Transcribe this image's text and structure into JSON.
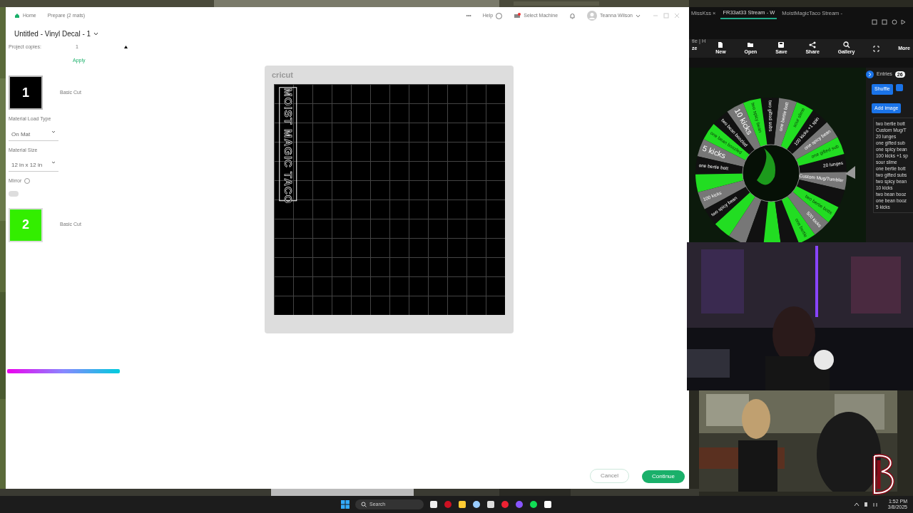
{
  "cricut": {
    "breadcrumbs": [
      {
        "label": "Home",
        "kind": "home"
      },
      {
        "label": "Prepare (2 mats)",
        "kind": "plain"
      }
    ],
    "header": {
      "more": "•••",
      "help": "Help",
      "machine": "Select Machine",
      "user": "Teanna Wilson"
    },
    "project_title": "Untitled - Vinyl Decal - 1",
    "copies": {
      "label": "Project copies:",
      "value": "1",
      "apply": "Apply"
    },
    "mats": [
      {
        "number": "1",
        "color": "#000000",
        "mode": "Basic Cut",
        "selected": true
      },
      {
        "number": "2",
        "color": "#33ee00",
        "mode": "Basic Cut",
        "selected": false
      }
    ],
    "settings": {
      "load_label": "Material Load Type",
      "load_value": "On Mat",
      "size_label": "Material Size",
      "size_value": "12 in x 12 in",
      "mirror_label": "Mirror",
      "mirror_on": false
    },
    "canvas": {
      "logo": "cricut",
      "design_text": "MOIST MAGIC TACO"
    },
    "footer": {
      "cancel": "Cancel",
      "continue": "Continue"
    }
  },
  "browser": {
    "tabs": [
      {
        "label": "MissKss ×",
        "selected": false
      },
      {
        "label": "FR33at33 Stream - W",
        "selected": true
      },
      {
        "label": "MoistMagicTaco Stream -",
        "selected": false
      }
    ],
    "address": "tle | H",
    "toolbar": [
      {
        "label": "ze",
        "kind": "none"
      },
      {
        "label": "New",
        "kind": "file"
      },
      {
        "label": "Open",
        "kind": "folder"
      },
      {
        "label": "Save",
        "kind": "disk"
      },
      {
        "label": "Share",
        "kind": "share"
      },
      {
        "label": "Gallery",
        "kind": "search"
      },
      {
        "label": "More",
        "kind": "none"
      }
    ],
    "wheel": {
      "segments": [
        {
          "label": "Custom Mug/Tumbler",
          "color": "#777777"
        },
        {
          "label": "20 lunges",
          "color": "#111111"
        },
        {
          "label": "one gifted sub",
          "color": "#22dd22"
        },
        {
          "label": "one spicy bean",
          "color": "#777777"
        },
        {
          "label": "100 kicks +1 spin",
          "color": "#111111"
        },
        {
          "label": "sour slime",
          "color": "#22dd22"
        },
        {
          "label": "one bertie bott",
          "color": "#777777"
        },
        {
          "label": "two gifted subs",
          "color": "#111111"
        },
        {
          "label": "two spicy bean",
          "color": "#22dd22"
        },
        {
          "label": "10 kicks",
          "color": "#777777"
        },
        {
          "label": "two bean boozled",
          "color": "#111111"
        },
        {
          "label": "one bean boozled",
          "color": "#22dd22"
        },
        {
          "label": "5 kicks",
          "color": "#777777"
        },
        {
          "label": "one bertie bott",
          "color": "#111111"
        },
        {
          "color": "#22dd22"
        },
        {
          "label": "100 kicks",
          "color": "#777777"
        },
        {
          "label": "two spicy bean",
          "color": "#111111"
        },
        {
          "color": "#22dd22"
        },
        {
          "color": "#777777"
        },
        {
          "color": "#111111"
        },
        {
          "color": "#22dd22"
        },
        {
          "color": "#111111"
        },
        {
          "label": "one bertie",
          "color": "#22dd22"
        },
        {
          "label": "500 kicks",
          "color": "#777777"
        },
        {
          "label": "two bertie botts",
          "color": "#22dd22"
        },
        {
          "color": "#111111"
        }
      ]
    },
    "entries": {
      "title": "Entries",
      "count": "26",
      "shuffle": "Shuffle",
      "add_image": "Add image",
      "items": [
        "two bertie bott",
        "Custom Mug/T",
        "20 lunges",
        "one gifted sub",
        "one spicy bean",
        "100 kicks +1 sp",
        "sour slime",
        "one bertie bott",
        "two gifted subs",
        "two spicy bean",
        "10 kicks",
        "two bean booz",
        "one bean booz",
        "5 kicks"
      ]
    }
  },
  "taskbar": {
    "search": "Search",
    "time": "1:52 PM",
    "date": "3/8/2025"
  }
}
